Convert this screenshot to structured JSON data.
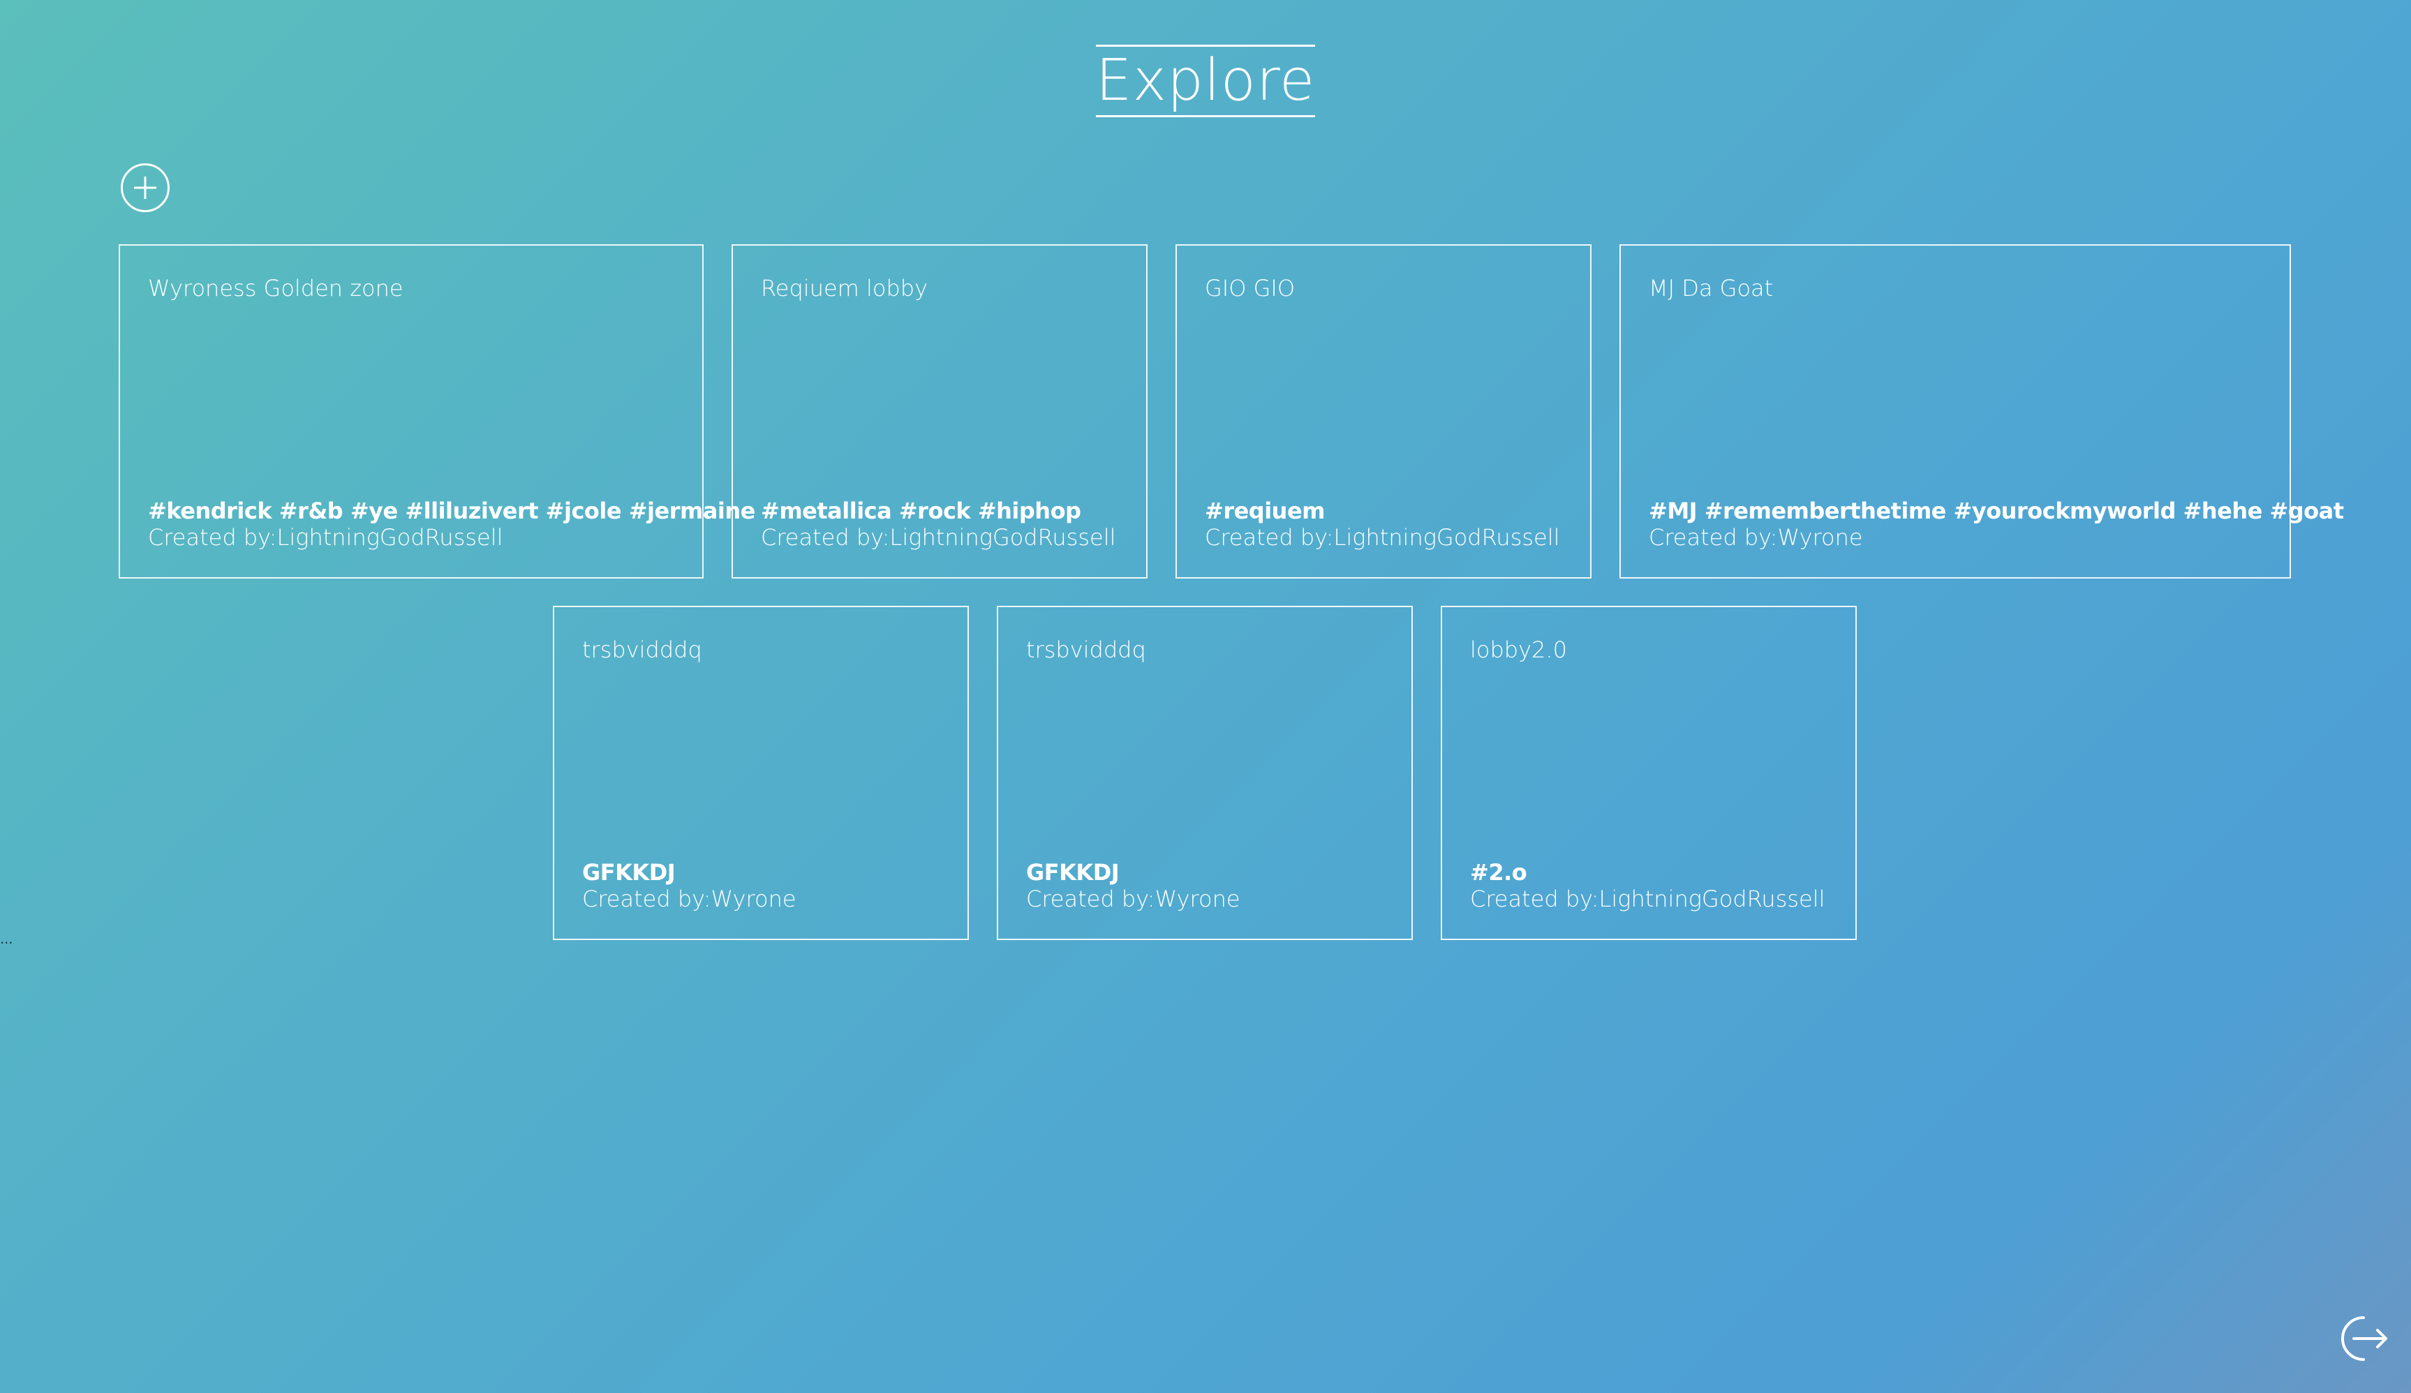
{
  "header": {
    "title": "Explore"
  },
  "toolbar": {
    "add_icon": "plus-circle-icon",
    "logout_icon": "logout-arrow-icon"
  },
  "lobbies": [
    {
      "name": "Wyroness Golden zone",
      "tags": "#kendrick #r&b #ye #lliluzivert #jcole #jermaine",
      "creator": "Created by:LightningGodRussell"
    },
    {
      "name": "Reqiuem lobby",
      "tags": "#metallica #rock #hiphop",
      "creator": "Created by:LightningGodRussell"
    },
    {
      "name": "GIO GIO",
      "tags": "#reqiuem",
      "creator": "Created by:LightningGodRussell"
    },
    {
      "name": "MJ Da Goat",
      "tags": "#MJ #rememberthetime #yourockmyworld #hehe #goat",
      "creator": "Created by:Wyrone"
    },
    {
      "name": "trsbvidddq",
      "tags": "GFKKDJ",
      "creator": "Created by:Wyrone"
    },
    {
      "name": "trsbvidddq",
      "tags": "GFKKDJ",
      "creator": "Created by:Wyrone"
    },
    {
      "name": "lobby2.0",
      "tags": "#2.o",
      "creator": "Created by:LightningGodRussell"
    }
  ],
  "misc": {
    "side_marker": "..."
  },
  "colors": {
    "text": "#ffffff",
    "bg_start": "#5bbfbb",
    "bg_end": "#6a97c4"
  }
}
